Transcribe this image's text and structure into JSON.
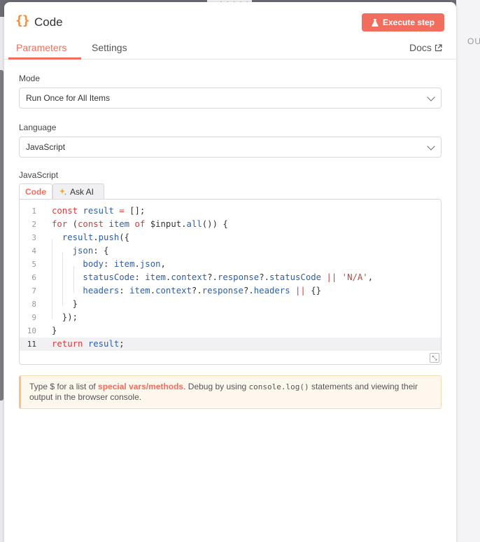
{
  "colors": {
    "accent": "#f16e5e",
    "icon_orange": "#f08a3c",
    "hint_bg": "#fef7ee"
  },
  "right_pane": {
    "text": "OU"
  },
  "header": {
    "title_icon": "{}",
    "title": "Code",
    "execute_label": "Execute step",
    "execute_icon": "flask-icon",
    "tabs": [
      {
        "label": "Parameters",
        "active": true
      },
      {
        "label": "Settings",
        "active": false
      }
    ],
    "docs_label": "Docs",
    "docs_icon": "external-link-icon"
  },
  "mode": {
    "label": "Mode",
    "value": "Run Once for All Items"
  },
  "language": {
    "label": "Language",
    "value": "JavaScript"
  },
  "editor": {
    "label": "JavaScript",
    "tabs": [
      {
        "label": "Code",
        "active": true
      },
      {
        "label": "Ask AI",
        "icon": "sparkle-icon"
      }
    ],
    "active_line": 11,
    "lines": [
      "const result = [];",
      "for (const item of $input.all()) {",
      "  result.push({",
      "    json: {",
      "      body: item.json,",
      "      statusCode: item.context?.response?.statusCode || 'N/A',",
      "      headers: item.context?.response?.headers || {}",
      "    }",
      "  });",
      "}",
      "return result;"
    ]
  },
  "hint": {
    "prefix": "Type $ for a list of ",
    "link": "special vars/methods",
    "middle": ". Debug by using ",
    "code": "console.log()",
    "suffix": " statements and viewing their output in the browser console."
  }
}
